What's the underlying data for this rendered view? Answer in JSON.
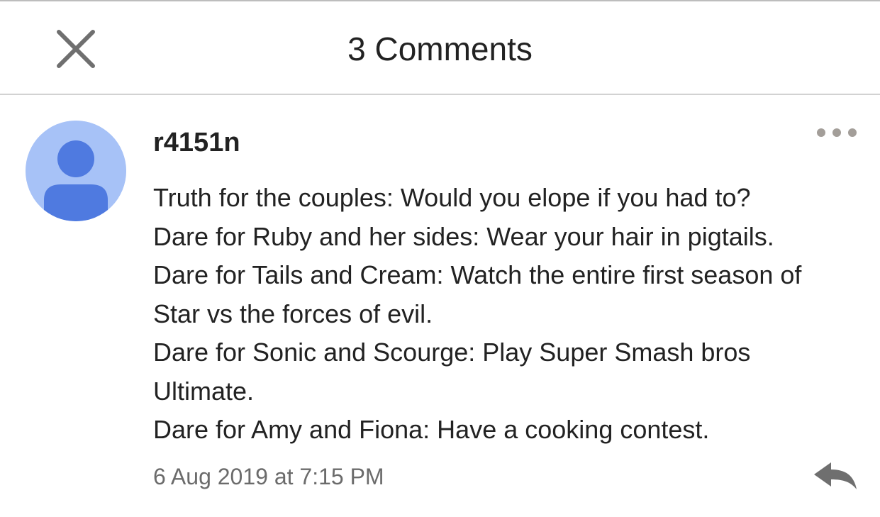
{
  "header": {
    "title": "3 Comments",
    "close_icon": "close-icon"
  },
  "comment": {
    "username": "r4151n",
    "avatar_icon": "default-user-avatar",
    "more_icon": "more-options-icon",
    "lines": [
      "Truth for the couples: Would you elope if you had to?",
      "Dare for Ruby and her sides: Wear your hair in pigtails.",
      "Dare for Tails and Cream: Watch the entire first season of",
      "Star vs the forces of evil.",
      "Dare for Sonic and Scourge: Play Super Smash bros",
      "Ultimate.",
      "Dare for Amy and Fiona: Have a cooking contest."
    ],
    "timestamp": "6 Aug 2019 at 7:15 PM",
    "reply_icon": "reply-icon"
  },
  "colors": {
    "avatar_background": "#a7c2f7",
    "avatar_figure": "#4f7ae0",
    "icon_gray": "#6f6f6f",
    "more_dots": "#a39e99",
    "timestamp_text": "#6b6b6b"
  }
}
